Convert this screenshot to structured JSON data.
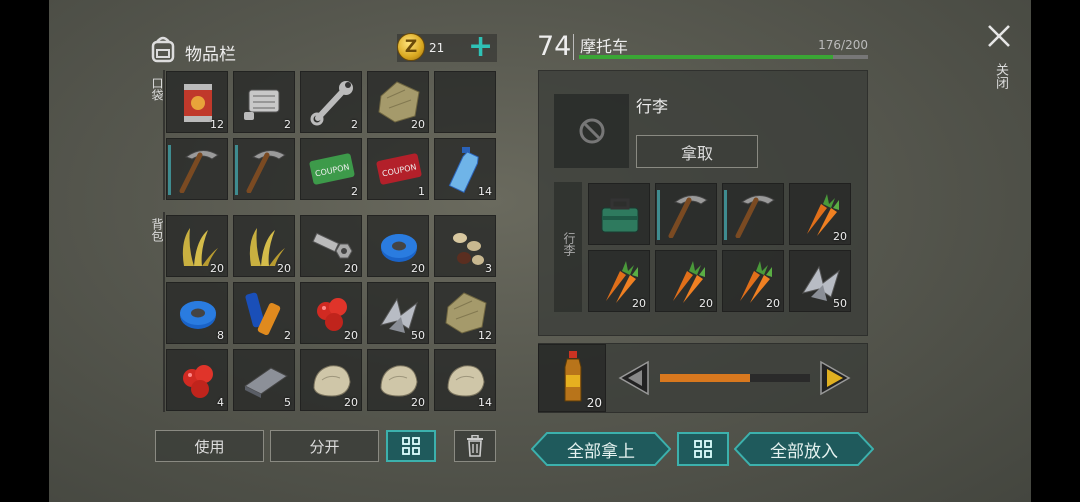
{
  "inventory": {
    "title": "物品栏",
    "coins": "21",
    "coin_symbol": "Z",
    "add_symbol": "+",
    "pocket_label": "口袋",
    "backpack_label": "背包",
    "pocket_items": [
      {
        "icon": "canned-food-icon",
        "count": "12"
      },
      {
        "icon": "engine-part-icon",
        "count": "2"
      },
      {
        "icon": "wrench-icon",
        "count": "2"
      },
      {
        "icon": "cloth-icon",
        "count": "20"
      },
      {
        "icon": "empty-slot",
        "count": ""
      },
      {
        "icon": "pickaxe-icon",
        "count": ""
      },
      {
        "icon": "pickaxe-icon",
        "count": ""
      },
      {
        "icon": "ration-coupon-icon",
        "count": "2"
      },
      {
        "icon": "combat-gear-coupon-icon",
        "count": "1"
      },
      {
        "icon": "water-bottle-icon",
        "count": "14"
      }
    ],
    "backpack_items": [
      {
        "icon": "plant-fiber-icon",
        "count": "20"
      },
      {
        "icon": "plant-fiber-icon",
        "count": "20"
      },
      {
        "icon": "bolt-nut-icon",
        "count": "20"
      },
      {
        "icon": "duct-tape-icon",
        "count": "20"
      },
      {
        "icon": "seeds-icon",
        "count": "3"
      },
      {
        "icon": "duct-tape-icon",
        "count": "8"
      },
      {
        "icon": "battery-icon",
        "count": "2"
      },
      {
        "icon": "berries-icon",
        "count": "20"
      },
      {
        "icon": "scrap-metal-icon",
        "count": "50"
      },
      {
        "icon": "cloth-icon",
        "count": "12"
      },
      {
        "icon": "berries-icon",
        "count": "4"
      },
      {
        "icon": "iron-bar-icon",
        "count": "5"
      },
      {
        "icon": "stone-icon",
        "count": "20"
      },
      {
        "icon": "stone-icon",
        "count": "20"
      },
      {
        "icon": "stone-icon",
        "count": "14"
      }
    ],
    "use_label": "使用",
    "split_label": "分开"
  },
  "vehicle": {
    "level": "74",
    "name": "摩托车",
    "durability_text": "176/200",
    "durability_fraction": 0.88,
    "luggage_label": "行李",
    "take_label": "拿取",
    "side_label": "行李",
    "items": [
      {
        "icon": "toolbox-icon",
        "count": ""
      },
      {
        "icon": "pickaxe-icon",
        "count": ""
      },
      {
        "icon": "pickaxe-icon",
        "count": ""
      },
      {
        "icon": "carrot-icon",
        "count": "20"
      },
      {
        "icon": "carrot-icon",
        "count": "20"
      },
      {
        "icon": "carrot-icon",
        "count": "20"
      },
      {
        "icon": "carrot-icon",
        "count": "20"
      },
      {
        "icon": "scrap-metal-icon",
        "count": "50"
      }
    ],
    "fuel_count": "20",
    "fuel_fraction": 0.6,
    "take_all_label": "全部拿上",
    "put_all_label": "全部放入"
  },
  "close_label": "关闭",
  "colors": {
    "teal": "#3cb1ad",
    "green_bar": "#3aa635",
    "orange_bar": "#d9781e",
    "gold": "#d9a820"
  }
}
